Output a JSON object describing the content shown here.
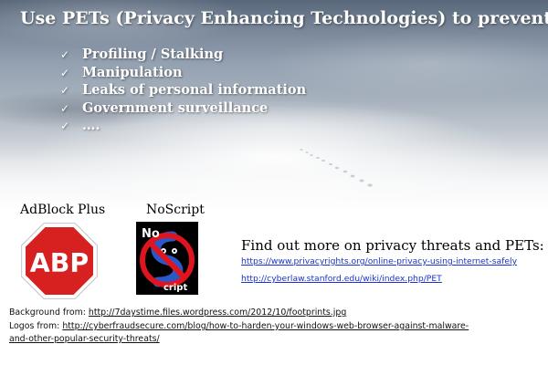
{
  "title": "Use PETs (Privacy Enhancing Technologies) to prevent:",
  "bullets": [
    "Profiling / Stalking",
    "Manipulation",
    "Leaks of personal information",
    "Government surveillance",
    "…."
  ],
  "check_glyph": "✓",
  "logos": {
    "adblock": {
      "label": "AdBlock Plus",
      "text": "ABP"
    },
    "noscript": {
      "label": "NoScript",
      "text_no": "No",
      "text_script": "cript"
    }
  },
  "info": {
    "title": "Find out more on privacy threats and PETs:",
    "links": [
      "https://www.privacyrights.org/online-privacy-using-internet-safely",
      "http://cyberlaw.stanford.edu/wiki/index.php/PET"
    ]
  },
  "credits": {
    "background_label": "Background from:",
    "background_url": "http://7daystime.files.wordpress.com/2012/10/footprints.jpg",
    "logos_label": "Logos from:",
    "logos_url_line1": "http://cyberfraudsecure.com/blog/how-to-harden-your-windows-web-browser-against-malware-",
    "logos_url_line2": "and-other-popular-security-threats/"
  },
  "colors": {
    "text_light": "#ffffff",
    "link": "#1a33cc",
    "abp_red": "#d72020",
    "noscript_red": "#e0141e",
    "noscript_blue": "#2b58c8"
  }
}
